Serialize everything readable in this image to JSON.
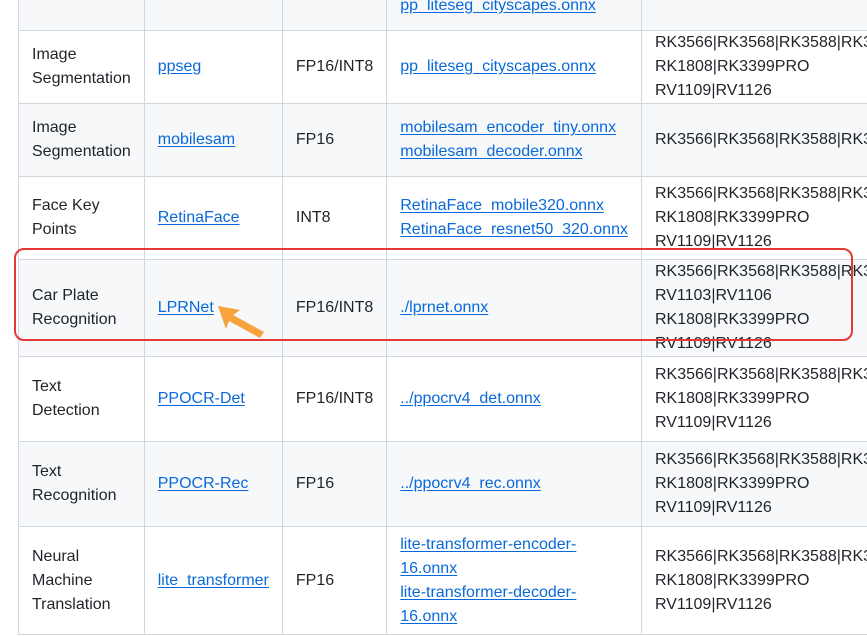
{
  "table": {
    "rows": [
      {
        "task": [
          "",
          ""
        ],
        "model": "",
        "dtype": "",
        "files": [
          "pp_liteseg_cityscapes.onnx"
        ],
        "platforms": [
          ""
        ]
      },
      {
        "task": [
          "Image",
          "Segmentation"
        ],
        "model": "ppseg",
        "dtype": "FP16/INT8",
        "files": [
          "pp_liteseg_cityscapes.onnx"
        ],
        "platforms": [
          "RK3566|RK3568|RK3588|RK3",
          "RK1808|RK3399PRO",
          "RV1109|RV1126"
        ]
      },
      {
        "task": [
          "Image",
          "Segmentation"
        ],
        "model": "mobilesam",
        "dtype": "FP16",
        "files": [
          "mobilesam_encoder_tiny.onnx",
          "mobilesam_decoder.onnx"
        ],
        "platforms": [
          "RK3566|RK3568|RK3588|RK3"
        ]
      },
      {
        "task": [
          "Face Key",
          "Points"
        ],
        "model": "RetinaFace",
        "dtype": "INT8",
        "files": [
          "RetinaFace_mobile320.onnx",
          "RetinaFace_resnet50_320.onnx"
        ],
        "platforms": [
          "RK3566|RK3568|RK3588|RK3",
          "RK1808|RK3399PRO",
          "RV1109|RV1126"
        ]
      },
      {
        "task": [
          "Car Plate",
          "Recognition"
        ],
        "model": "LPRNet",
        "dtype": "FP16/INT8",
        "files": [
          "./lprnet.onnx"
        ],
        "platforms": [
          "RK3566|RK3568|RK3588|RK3",
          "RV1103|RV1106",
          "RK1808|RK3399PRO",
          "RV1109|RV1126"
        ]
      },
      {
        "task": [
          "Text",
          "Detection"
        ],
        "model": "PPOCR-Det",
        "dtype": "FP16/INT8",
        "files": [
          "../ppocrv4_det.onnx"
        ],
        "platforms": [
          "RK3566|RK3568|RK3588|RK3",
          "RK1808|RK3399PRO",
          "RV1109|RV1126"
        ]
      },
      {
        "task": [
          "Text",
          "Recognition"
        ],
        "model": "PPOCR-Rec",
        "dtype": "FP16",
        "files": [
          "../ppocrv4_rec.onnx"
        ],
        "platforms": [
          "RK3566|RK3568|RK3588|RK3",
          "RK1808|RK3399PRO",
          "RV1109|RV1126"
        ]
      },
      {
        "task": [
          "Neural",
          "Machine",
          "Translation"
        ],
        "model": "lite_transformer",
        "dtype": "FP16",
        "files": [
          "lite-transformer-encoder-",
          "16.onnx",
          "lite-transformer-decoder-",
          "16.onnx"
        ],
        "platforms": [
          "RK3566|RK3568|RK3588|RK3",
          "RK1808|RK3399PRO",
          "RV1109|RV1126"
        ]
      }
    ]
  },
  "colors": {
    "link": "#0969da",
    "border": "#d0d7de",
    "stripe": "#f6f8fa",
    "highlight": "#e53935",
    "cursor": "#f7a23b"
  }
}
